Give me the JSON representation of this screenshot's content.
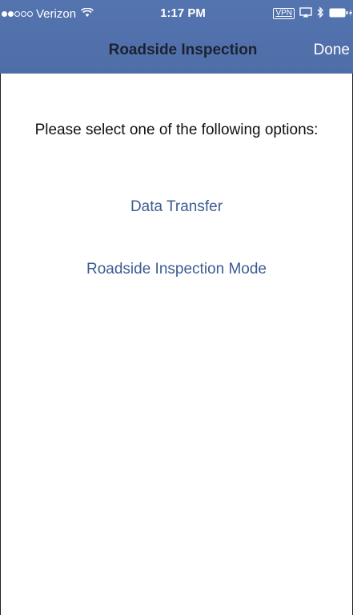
{
  "status_bar": {
    "signal": [
      true,
      true,
      false,
      false,
      false
    ],
    "carrier": "Verizon",
    "time": "1:17 PM",
    "vpn": "VPN",
    "icons": [
      "wifi-icon",
      "airplay-icon",
      "bluetooth-icon",
      "battery-icon"
    ]
  },
  "nav": {
    "title": "Roadside Inspection",
    "done_label": "Done"
  },
  "content": {
    "prompt": "Please select one of the following options:",
    "options": [
      {
        "label": "Data Transfer"
      },
      {
        "label": "Roadside Inspection Mode"
      }
    ]
  },
  "colors": {
    "header": "#5272ad",
    "title": "#1a2230",
    "link": "#3c5c93"
  }
}
